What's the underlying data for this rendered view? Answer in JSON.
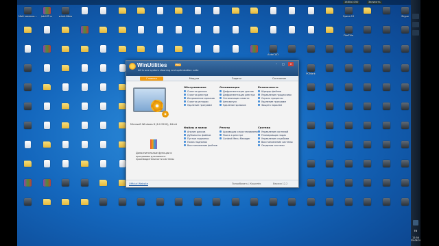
{
  "desktop_icons": [
    {
      "label": "Мой компьютер",
      "kind": "app"
    },
    {
      "label": "job.KIT.ru",
      "kind": "rar"
    },
    {
      "label": "winutilities",
      "kind": "app"
    },
    {
      "label": "",
      "kind": "doc"
    },
    {
      "label": "",
      "kind": "doc"
    },
    {
      "label": "",
      "kind": "folder"
    },
    {
      "label": "",
      "kind": "folder"
    },
    {
      "label": "",
      "kind": "doc"
    },
    {
      "label": "",
      "kind": "folder"
    },
    {
      "label": "",
      "kind": "doc"
    },
    {
      "label": "",
      "kind": "doc"
    },
    {
      "label": "",
      "kind": "folder"
    },
    {
      "label": "",
      "kind": "folder"
    },
    {
      "label": "",
      "kind": "doc"
    },
    {
      "label": "",
      "kind": "doc"
    },
    {
      "label": "",
      "kind": "doc"
    },
    {
      "label": "",
      "kind": "folder"
    },
    {
      "label": "Opera 12",
      "kind": "app"
    },
    {
      "label": "",
      "kind": "folder"
    },
    {
      "label": "",
      "kind": "app"
    },
    {
      "label": "Skype",
      "kind": "app"
    },
    {
      "label": "",
      "kind": "folder"
    },
    {
      "label": "",
      "kind": "doc"
    },
    {
      "label": "",
      "kind": "folder"
    },
    {
      "label": "",
      "kind": "rar"
    },
    {
      "label": "",
      "kind": "folder"
    },
    {
      "label": "",
      "kind": "folder"
    },
    {
      "label": "",
      "kind": "doc"
    },
    {
      "label": "",
      "kind": "doc"
    },
    {
      "label": "",
      "kind": "doc"
    },
    {
      "label": "",
      "kind": "doc"
    },
    {
      "label": "",
      "kind": "doc"
    },
    {
      "label": "",
      "kind": "doc"
    },
    {
      "label": "",
      "kind": "folder"
    },
    {
      "label": "",
      "kind": "doc"
    },
    {
      "label": "",
      "kind": "doc"
    },
    {
      "label": "",
      "kind": "doc"
    },
    {
      "label": "",
      "kind": "folder"
    },
    {
      "label": "FileZilla",
      "kind": "app"
    },
    {
      "label": "",
      "kind": "app"
    },
    {
      "label": "",
      "kind": "app"
    },
    {
      "label": "",
      "kind": "app"
    },
    {
      "label": "",
      "kind": "doc"
    },
    {
      "label": "",
      "kind": "rar"
    },
    {
      "label": "",
      "kind": "folder"
    },
    {
      "label": "",
      "kind": "folder"
    },
    {
      "label": "",
      "kind": "doc"
    },
    {
      "label": "",
      "kind": "folder"
    },
    {
      "label": "",
      "kind": "folder"
    },
    {
      "label": "",
      "kind": "doc"
    },
    {
      "label": "",
      "kind": "folder"
    },
    {
      "label": "",
      "kind": "doc"
    },
    {
      "label": "",
      "kind": "doc"
    },
    {
      "label": "",
      "kind": "doc"
    },
    {
      "label": "",
      "kind": "rar"
    },
    {
      "label": "AutoCAD",
      "kind": "app"
    },
    {
      "label": "",
      "kind": "app"
    },
    {
      "label": "",
      "kind": "app"
    },
    {
      "label": "",
      "kind": "app"
    },
    {
      "label": "",
      "kind": "app"
    },
    {
      "label": "",
      "kind": "app"
    },
    {
      "label": "",
      "kind": "app"
    },
    {
      "label": "",
      "kind": "app"
    },
    {
      "label": "",
      "kind": "app"
    },
    {
      "label": "",
      "kind": "doc"
    },
    {
      "label": "",
      "kind": "folder"
    },
    {
      "label": "",
      "kind": "doc"
    },
    {
      "label": "",
      "kind": "doc"
    },
    {
      "label": "",
      "kind": "doc"
    },
    {
      "label": "",
      "kind": "doc"
    },
    {
      "label": "",
      "kind": "folder"
    },
    {
      "label": "",
      "kind": "doc"
    },
    {
      "label": "",
      "kind": "doc"
    },
    {
      "label": "",
      "kind": "doc"
    },
    {
      "label": "",
      "kind": "doc"
    },
    {
      "label": "",
      "kind": "doc"
    },
    {
      "label": "",
      "kind": "app"
    },
    {
      "label": "",
      "kind": "app"
    },
    {
      "label": "PCMark",
      "kind": "app"
    },
    {
      "label": "",
      "kind": "app"
    },
    {
      "label": "",
      "kind": "app"
    },
    {
      "label": "",
      "kind": "app"
    },
    {
      "label": "",
      "kind": "app"
    },
    {
      "label": "",
      "kind": "app"
    },
    {
      "label": "",
      "kind": "app"
    },
    {
      "label": "",
      "kind": "folder"
    },
    {
      "label": "",
      "kind": "doc"
    },
    {
      "label": "",
      "kind": "doc"
    },
    {
      "label": "",
      "kind": "doc"
    },
    {
      "label": "",
      "kind": "folder"
    },
    {
      "label": "",
      "kind": "folder"
    },
    {
      "label": "",
      "kind": "folder"
    },
    {
      "label": "",
      "kind": "doc"
    },
    {
      "label": "",
      "kind": "doc"
    },
    {
      "label": "",
      "kind": "doc"
    },
    {
      "label": "",
      "kind": "doc"
    },
    {
      "label": "",
      "kind": "doc"
    },
    {
      "label": "",
      "kind": "app"
    },
    {
      "label": "",
      "kind": "app"
    },
    {
      "label": "",
      "kind": "app"
    },
    {
      "label": "",
      "kind": "app"
    },
    {
      "label": "",
      "kind": "app"
    },
    {
      "label": "",
      "kind": "app"
    },
    {
      "label": "",
      "kind": "app"
    },
    {
      "label": "",
      "kind": "app"
    },
    {
      "label": "",
      "kind": "app"
    },
    {
      "label": "",
      "kind": "doc"
    },
    {
      "label": "",
      "kind": "folder"
    },
    {
      "label": "",
      "kind": "doc"
    },
    {
      "label": "",
      "kind": "doc"
    },
    {
      "label": "",
      "kind": "folder"
    },
    {
      "label": "",
      "kind": "folder"
    },
    {
      "label": "",
      "kind": "doc"
    },
    {
      "label": "",
      "kind": "doc"
    },
    {
      "label": "",
      "kind": "doc"
    },
    {
      "label": "",
      "kind": "doc"
    },
    {
      "label": "",
      "kind": "doc"
    },
    {
      "label": "",
      "kind": "doc"
    },
    {
      "label": "",
      "kind": "app"
    },
    {
      "label": "",
      "kind": "app"
    },
    {
      "label": "",
      "kind": "app"
    },
    {
      "label": "",
      "kind": "app"
    },
    {
      "label": "",
      "kind": "app"
    },
    {
      "label": "",
      "kind": "app"
    },
    {
      "label": "",
      "kind": "app"
    },
    {
      "label": "",
      "kind": "app"
    },
    {
      "label": "",
      "kind": "app"
    },
    {
      "label": "",
      "kind": "doc"
    },
    {
      "label": "",
      "kind": "folder"
    },
    {
      "label": "",
      "kind": "doc"
    },
    {
      "label": "",
      "kind": "doc"
    },
    {
      "label": "",
      "kind": "folder"
    },
    {
      "label": "",
      "kind": "doc"
    },
    {
      "label": "",
      "kind": "doc"
    },
    {
      "label": "",
      "kind": "doc"
    },
    {
      "label": "",
      "kind": "doc"
    },
    {
      "label": "",
      "kind": "doc"
    },
    {
      "label": "",
      "kind": "doc"
    },
    {
      "label": "",
      "kind": "doc"
    },
    {
      "label": "",
      "kind": "app"
    },
    {
      "label": "",
      "kind": "app"
    },
    {
      "label": "",
      "kind": "app"
    },
    {
      "label": "",
      "kind": "app"
    },
    {
      "label": "",
      "kind": "app"
    },
    {
      "label": "",
      "kind": "app"
    },
    {
      "label": "",
      "kind": "app"
    },
    {
      "label": "",
      "kind": "app"
    },
    {
      "label": "",
      "kind": "doc"
    },
    {
      "label": "",
      "kind": "folder"
    },
    {
      "label": "",
      "kind": "doc"
    },
    {
      "label": "",
      "kind": "doc"
    },
    {
      "label": "",
      "kind": "doc"
    },
    {
      "label": "",
      "kind": "folder"
    },
    {
      "label": "",
      "kind": "doc"
    },
    {
      "label": "",
      "kind": "doc"
    },
    {
      "label": "",
      "kind": "doc"
    },
    {
      "label": "",
      "kind": "doc"
    },
    {
      "label": "",
      "kind": "doc"
    },
    {
      "label": "",
      "kind": "doc"
    },
    {
      "label": "",
      "kind": "doc"
    },
    {
      "label": "",
      "kind": "app"
    },
    {
      "label": "",
      "kind": "app"
    },
    {
      "label": "",
      "kind": "app"
    },
    {
      "label": "",
      "kind": "app"
    },
    {
      "label": "",
      "kind": "app"
    },
    {
      "label": "",
      "kind": "app"
    },
    {
      "label": "",
      "kind": "app"
    },
    {
      "label": "",
      "kind": "app"
    },
    {
      "label": "",
      "kind": "folder"
    },
    {
      "label": "",
      "kind": "doc"
    },
    {
      "label": "",
      "kind": "doc"
    },
    {
      "label": "",
      "kind": "folder"
    },
    {
      "label": "",
      "kind": "doc"
    },
    {
      "label": "",
      "kind": "doc"
    },
    {
      "label": "",
      "kind": "doc"
    },
    {
      "label": "",
      "kind": "doc"
    },
    {
      "label": "",
      "kind": "doc"
    },
    {
      "label": "",
      "kind": "doc"
    },
    {
      "label": "",
      "kind": "doc"
    },
    {
      "label": "",
      "kind": "doc"
    },
    {
      "label": "",
      "kind": "doc"
    },
    {
      "label": "",
      "kind": "app"
    },
    {
      "label": "",
      "kind": "app"
    },
    {
      "label": "",
      "kind": "app"
    },
    {
      "label": "",
      "kind": "app"
    },
    {
      "label": "",
      "kind": "app"
    },
    {
      "label": "",
      "kind": "app"
    },
    {
      "label": "",
      "kind": "app"
    },
    {
      "label": "",
      "kind": "app"
    },
    {
      "label": "",
      "kind": "rar"
    },
    {
      "label": "",
      "kind": "rar"
    },
    {
      "label": "",
      "kind": "app"
    },
    {
      "label": "",
      "kind": "app"
    },
    {
      "label": "",
      "kind": "folder"
    },
    {
      "label": "",
      "kind": "folder"
    },
    {
      "label": "",
      "kind": "app"
    },
    {
      "label": "",
      "kind": "app"
    },
    {
      "label": "",
      "kind": "app"
    },
    {
      "label": "",
      "kind": "app"
    },
    {
      "label": "",
      "kind": "app"
    },
    {
      "label": "",
      "kind": "app"
    },
    {
      "label": "",
      "kind": "app"
    },
    {
      "label": "",
      "kind": "app"
    },
    {
      "label": "",
      "kind": "app"
    },
    {
      "label": "",
      "kind": "app"
    },
    {
      "label": "",
      "kind": "app"
    },
    {
      "label": "",
      "kind": "app"
    },
    {
      "label": "",
      "kind": "app"
    },
    {
      "label": "",
      "kind": "app"
    },
    {
      "label": "",
      "kind": "app"
    },
    {
      "label": "",
      "kind": "app"
    },
    {
      "label": "",
      "kind": "folder"
    },
    {
      "label": "",
      "kind": "folder"
    },
    {
      "label": "",
      "kind": "folder"
    },
    {
      "label": "",
      "kind": "app"
    },
    {
      "label": "",
      "kind": "app"
    },
    {
      "label": "",
      "kind": "app"
    },
    {
      "label": "",
      "kind": "app"
    },
    {
      "label": "",
      "kind": "app"
    },
    {
      "label": "",
      "kind": "app"
    },
    {
      "label": "",
      "kind": "app"
    },
    {
      "label": "",
      "kind": "app"
    },
    {
      "label": "",
      "kind": "app"
    },
    {
      "label": "",
      "kind": "app"
    },
    {
      "label": "",
      "kind": "app"
    },
    {
      "label": "",
      "kind": "app"
    },
    {
      "label": "",
      "kind": "app"
    },
    {
      "label": "",
      "kind": "app"
    },
    {
      "label": "",
      "kind": "app"
    },
    {
      "label": "",
      "kind": "app"
    },
    {
      "label": "",
      "kind": "app"
    }
  ],
  "topbar": {
    "items": [
      "1680x1050",
      "Записать"
    ]
  },
  "taskbar": {
    "clock": "12:54",
    "date": "25.08.2015",
    "lang": "EN"
  },
  "window": {
    "title": "WinUtilities",
    "badge": "PRO",
    "subtitle": "All in one system cleaning and optimization suite",
    "controls": {
      "min": "–",
      "max": "□",
      "close": "×"
    },
    "tabs": [
      "Главная",
      "Модули",
      "Задачи",
      "Состояние"
    ],
    "os_info": "Microsoft Windows 8 (6.2.9200), 64-bit",
    "promo": "Дополнительные функции и программы для вашего производительности системы",
    "columns": [
      {
        "header": "Обслуживание",
        "items": [
          "Очистка дисков",
          "Очистка реестра",
          "Исправление ярлыков",
          "Очистка истории",
          "Удаление программ"
        ]
      },
      {
        "header": "Оптимизация",
        "items": [
          "Дефрагментация дисков",
          "Дефрагментация реестра",
          "Оптимизация памяти",
          "Автозапуск",
          "Удаление ярлыков"
        ]
      },
      {
        "header": "Безопасность",
        "items": [
          "Шредер файлов",
          "Управление процессами",
          "Скрыть процессы",
          "Удаление программ",
          "Защита паролем"
        ]
      },
      {
        "header": "Файлы и папки",
        "items": [
          "Анализ дисков",
          "Дубликаты файлов",
          "Пустые подпапки",
          "Поиск подпапок",
          "Восстановление файлов"
        ]
      },
      {
        "header": "Реестр",
        "items": [
          "Архивация и восстановление",
          "Поиск в реестре",
          "Context Menu Manager"
        ]
      },
      {
        "header": "Система",
        "items": [
          "Управление системой",
          "Планировщик задач",
          "Управление службами",
          "Восстановление системы",
          "Сведения системы"
        ]
      }
    ],
    "footer": {
      "link": "Official Website",
      "mid": "Попробовать | Кошелёк",
      "version": "Версия 12.2"
    }
  }
}
